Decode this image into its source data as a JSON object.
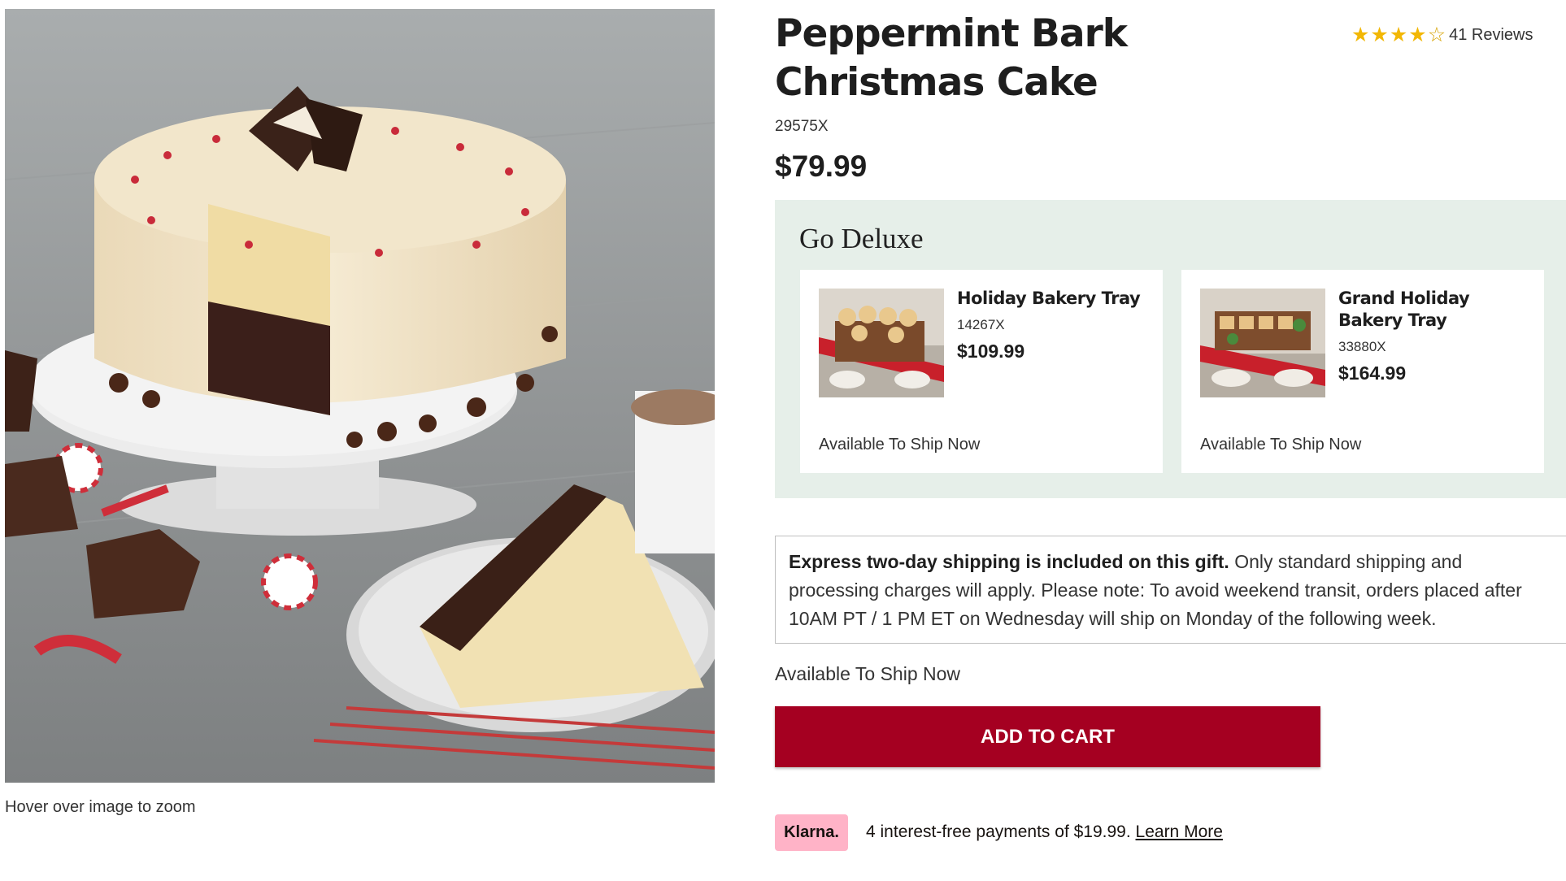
{
  "product": {
    "title": "Peppermint Bark Christmas Cake",
    "sku": "29575X",
    "price": "$79.99",
    "rating": {
      "value": 4,
      "max": 5,
      "reviews_label": "41 Reviews"
    },
    "image_hint": "Hover over image to zoom"
  },
  "deluxe": {
    "heading": "Go Deluxe",
    "items": [
      {
        "name": "Holiday Bakery Tray",
        "sku": "14267X",
        "price": "$109.99",
        "availability": "Available To Ship Now"
      },
      {
        "name": "Grand Holiday Bakery Tray",
        "sku": "33880X",
        "price": "$164.99",
        "availability": "Available To Ship Now"
      }
    ]
  },
  "shipping": {
    "bold": "Express two-day shipping is included on this gift.",
    "text": " Only standard shipping and processing charges will apply. Please note: To avoid weekend transit, orders placed after 10AM PT / 1 PM ET on Wednesday will ship on Monday of the following week."
  },
  "availability": "Available To Ship Now",
  "cart": {
    "button_label": "ADD TO CART",
    "button_color": "#a50021"
  },
  "klarna": {
    "badge": "Klarna.",
    "text": "4 interest-free payments of $19.99.",
    "link": "Learn More",
    "badge_color": "#ffb3c7"
  },
  "colors": {
    "deluxe_bg": "#e6efe9",
    "star": "#f2b705"
  },
  "icons": {
    "star": "star-icon",
    "star_empty": "star-outline-icon"
  }
}
